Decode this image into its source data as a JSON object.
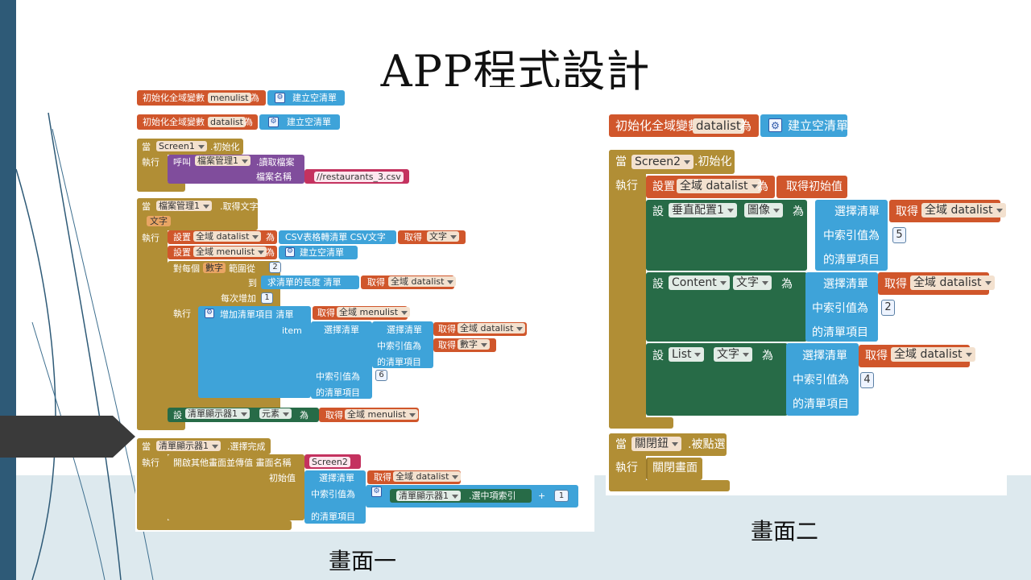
{
  "title": "APP程式設計",
  "captions": {
    "screen1": "畫面一",
    "screen2": "畫面二"
  },
  "p1": {
    "init_menulist": {
      "label": "初始化全域變數",
      "var": "menulist",
      "as": "為",
      "value": "建立空清單"
    },
    "init_datalist": {
      "label": "初始化全域變數",
      "var": "datalist",
      "as": "為",
      "value": "建立空清單"
    },
    "screen1": {
      "when": "當",
      "component": "Screen1",
      "event": ".初始化",
      "do": "執行",
      "call": "呼叫",
      "file": "檔案管理1",
      "method": ".讀取檔案",
      "param": "檔案名稱",
      "filename": "//restaurants_3.csv"
    },
    "file_event": {
      "when": "當",
      "component": "檔案管理1",
      "event": ".取得文字",
      "param": "文字",
      "do": "執行",
      "set1": "設置",
      "var1": "全域 datalist",
      "to": "為",
      "csv": "CSV表格轉清單  CSV文字",
      "get": "取得",
      "text": "文字",
      "var2": "全域 menulist",
      "empty": "建立空清單",
      "foreach": "對每個",
      "num": "數字",
      "range_from": "範圍從",
      "from_val": "2",
      "to_label": "到",
      "length": "求清單的長度  清單",
      "var_datalist": "全域 datalist",
      "step_label": "每次增加",
      "step_val": "1",
      "do2": "執行",
      "add": "增加清單項目  清單",
      "var_menulist": "全域 menulist",
      "item": "item",
      "select": "選擇清單",
      "index": "中索引值為",
      "list_item": "的清單項目",
      "num_get": "數字",
      "six": "6",
      "set_lv": "設",
      "lv": "清單顯示器1",
      "elements": "元素"
    },
    "after_pick": {
      "when": "當",
      "component": "清單顯示器1",
      "event": ".選擇完成",
      "do": "執行",
      "open": "開啟其他畫面並傳值  畫面名稱",
      "screen": "Screen2",
      "start": "初始值",
      "select": "選擇清單",
      "get": "取得",
      "var": "全域 datalist",
      "index": "中索引值為",
      "list_item": "的清單項目",
      "lv": "清單顯示器1",
      "sel_index": ".選中項索引",
      "plus": "+",
      "one": "1"
    }
  },
  "p2": {
    "init": {
      "label": "初始化全域變數",
      "var": "datalist",
      "as": "為",
      "value": "建立空清單"
    },
    "screen2": {
      "when": "當",
      "component": "Screen2",
      "event": ".初始化",
      "do": "執行",
      "set": "設置",
      "var": "全域 datalist",
      "as": "為",
      "start": "取得初始值",
      "set_short": "設",
      "img_comp": "垂直配置1",
      "img_prop": "圖像",
      "content": "Content",
      "list": "List",
      "text": "文字",
      "select": "選擇清單",
      "get": "取得",
      "index": "中索引值為",
      "list_item": "的清單項目",
      "n5": "5",
      "n2": "2",
      "n4": "4"
    },
    "close": {
      "when": "當",
      "component": "關閉鈕",
      "event": ".被點選",
      "do": "執行",
      "action": "關閉畫面"
    }
  },
  "colors": {
    "orange": "#d0562b",
    "olive": "#b18e35",
    "blue": "#3ea3d9",
    "green": "#276b47",
    "purple": "#804d9c",
    "chip": "#f3e1cf",
    "slate": "#2e5a77"
  }
}
